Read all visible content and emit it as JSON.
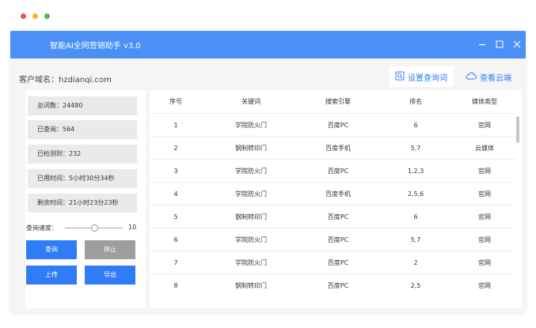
{
  "colors": {
    "accent": "#2f7cf6",
    "titlebar": "#4a90f7",
    "dot_red": "#ee5350",
    "dot_yellow": "#f5b91d",
    "dot_green": "#46c144"
  },
  "app": {
    "title": "智能AI全网营销助手 v3.0"
  },
  "domain": {
    "label": "客户域名：hzdianqi.com"
  },
  "tabs": [
    {
      "label": "设置查询词",
      "icon": "search-settings-icon"
    },
    {
      "label": "查看云端",
      "icon": "cloud-icon"
    }
  ],
  "stats": [
    {
      "label": "总词数：",
      "value": "24480"
    },
    {
      "label": "已查询：",
      "value": "564"
    },
    {
      "label": "已检测到：",
      "value": "232"
    },
    {
      "label": "已用时间：",
      "value": "5小时30分34秒"
    },
    {
      "label": "剩余时间：",
      "value": "21小时23分23秒"
    }
  ],
  "speed": {
    "label": "查询速度：",
    "value": "10"
  },
  "buttons": {
    "query": "查询",
    "stop": "停止",
    "upload": "上传",
    "export": "导出"
  },
  "table": {
    "headers": [
      "序号",
      "关键词",
      "搜索引擎",
      "排名",
      "媒体类型"
    ],
    "rows": [
      [
        "1",
        "学院防火门",
        "百度PC",
        "6",
        "官网"
      ],
      [
        "2",
        "钢制转印门",
        "百度手机",
        "5,7",
        "云媒体"
      ],
      [
        "3",
        "学院防火门",
        "百度PC",
        "1,2,3",
        "官网"
      ],
      [
        "4",
        "学院防火门",
        "百度手机",
        "2,5,6",
        "官网"
      ],
      [
        "5",
        "钢制转印门",
        "百度PC",
        "6",
        "官网"
      ],
      [
        "6",
        "学院防火门",
        "百度PC",
        "5,7",
        "官网"
      ],
      [
        "7",
        "学院防火门",
        "百度PC",
        "2",
        "官网"
      ],
      [
        "8",
        "钢制转印门",
        "百度PC",
        "2,5",
        "官网"
      ]
    ]
  }
}
